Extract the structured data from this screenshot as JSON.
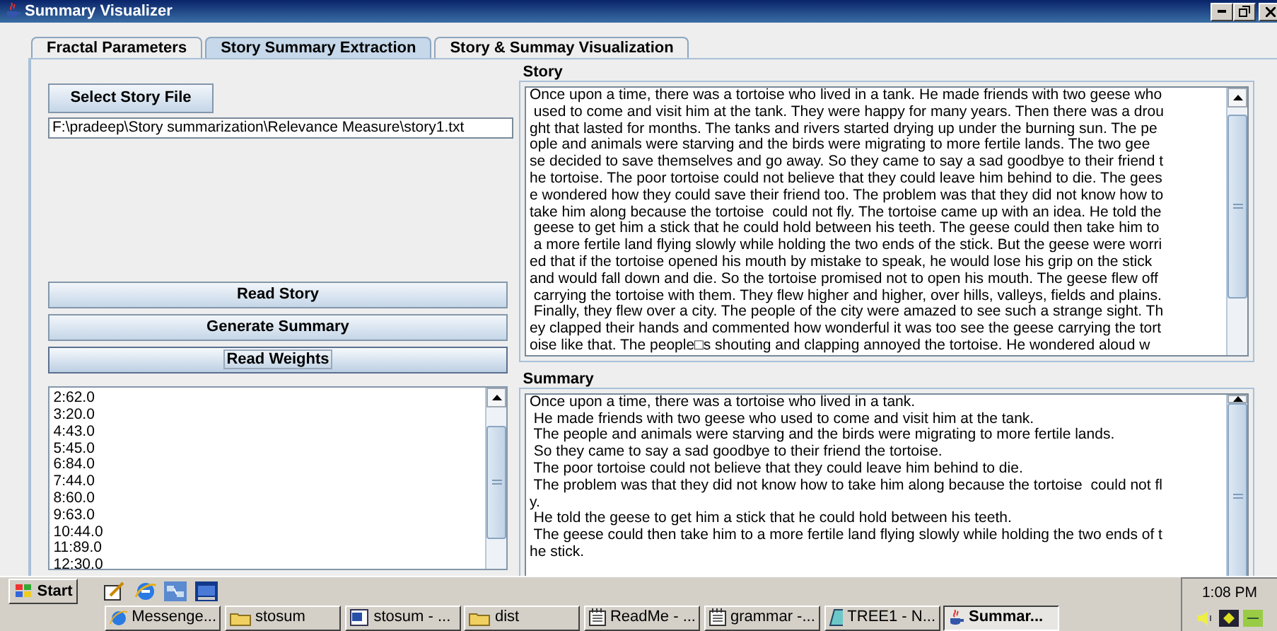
{
  "window": {
    "title": "Summary Visualizer"
  },
  "tabs": [
    {
      "label": "Fractal Parameters",
      "selected": false
    },
    {
      "label": "Story Summary Extraction",
      "selected": true
    },
    {
      "label": "Story & Summay Visualization",
      "selected": false
    }
  ],
  "file_button": "Select Story File",
  "file_path": "F:\\pradeep\\Story summarization\\Relevance Measure\\story1.txt",
  "actions": [
    {
      "label": "Read Story",
      "focused": false
    },
    {
      "label": "Generate Summary",
      "focused": false
    },
    {
      "label": "Read Weights",
      "focused": true
    }
  ],
  "weights": [
    "2:62.0",
    "3:20.0",
    "4:43.0",
    "5:45.0",
    "6:84.0",
    "7:44.0",
    "8:60.0",
    "9:63.0",
    "10:44.0",
    "11:89.0",
    "12:30.0"
  ],
  "story": {
    "title": "Story",
    "lines": [
      "Once upon a time, there was a tortoise who lived in a tank. He made friends with two geese who",
      " used to come and visit him at the tank. They were happy for many years. Then there was a drou",
      "ght that lasted for months. The tanks and rivers started drying up under the burning sun. The pe",
      "ople and animals were starving and the birds were migrating to more fertile lands. The two gee",
      "se decided to save themselves and go away. So they came to say a sad goodbye to their friend t",
      "he tortoise. The poor tortoise could not believe that they could leave him behind to die. The gees",
      "e wondered how they could save their friend too. The problem was that they did not know how to",
      "take him along because the tortoise  could not fly. The tortoise came up with an idea. He told the",
      " geese to get him a stick that he could hold between his teeth. The geese could then take him to",
      " a more fertile land flying slowly while holding the two ends of the stick. But the geese were worri",
      "ed that if the tortoise opened his mouth by mistake to speak, he would lose his grip on the stick",
      "and would fall down and die. So the tortoise promised not to open his mouth. The geese flew off",
      " carrying the tortoise with them. They flew higher and higher, over hills, valleys, fields and plains.",
      " Finally, they flew over a city. The people of the city were amazed to see such a strange sight. Th",
      "ey clapped their hands and commented how wonderful it was too see the geese carrying the tort",
      "oise like that. The people□s shouting and clapping annoyed the tortoise. He wondered aloud w"
    ]
  },
  "summary": {
    "title": "Summary",
    "lines": [
      "Once upon a time, there was a tortoise who lived in a tank.",
      " He made friends with two geese who used to come and visit him at the tank.",
      " The people and animals were starving and the birds were migrating to more fertile lands.",
      " So they came to say a sad goodbye to their friend the tortoise.",
      " The poor tortoise could not believe that they could leave him behind to die.",
      " The problem was that they did not know how to take him along because the tortoise  could not fl",
      "y.",
      " He told the geese to get him a stick that he could hold between his teeth.",
      " The geese could then take him to a more fertile land flying slowly while holding the two ends of t",
      "he stick."
    ]
  },
  "taskbar": {
    "start": "Start",
    "tasks": [
      {
        "label": "Messenge...",
        "kind": "browser",
        "selected": false
      },
      {
        "label": "stosum",
        "kind": "folder",
        "selected": false
      },
      {
        "label": "stosum - ...",
        "kind": "document",
        "selected": false
      },
      {
        "label": "dist",
        "kind": "folder",
        "selected": false
      },
      {
        "label": "ReadMe - ...",
        "kind": "notepad",
        "selected": false
      },
      {
        "label": "grammar -...",
        "kind": "notepad",
        "selected": false
      },
      {
        "label": "TREE1 - N...",
        "kind": "book",
        "selected": false
      },
      {
        "label": "Summar...",
        "kind": "java",
        "selected": true
      }
    ],
    "clock": "1:08 PM"
  }
}
